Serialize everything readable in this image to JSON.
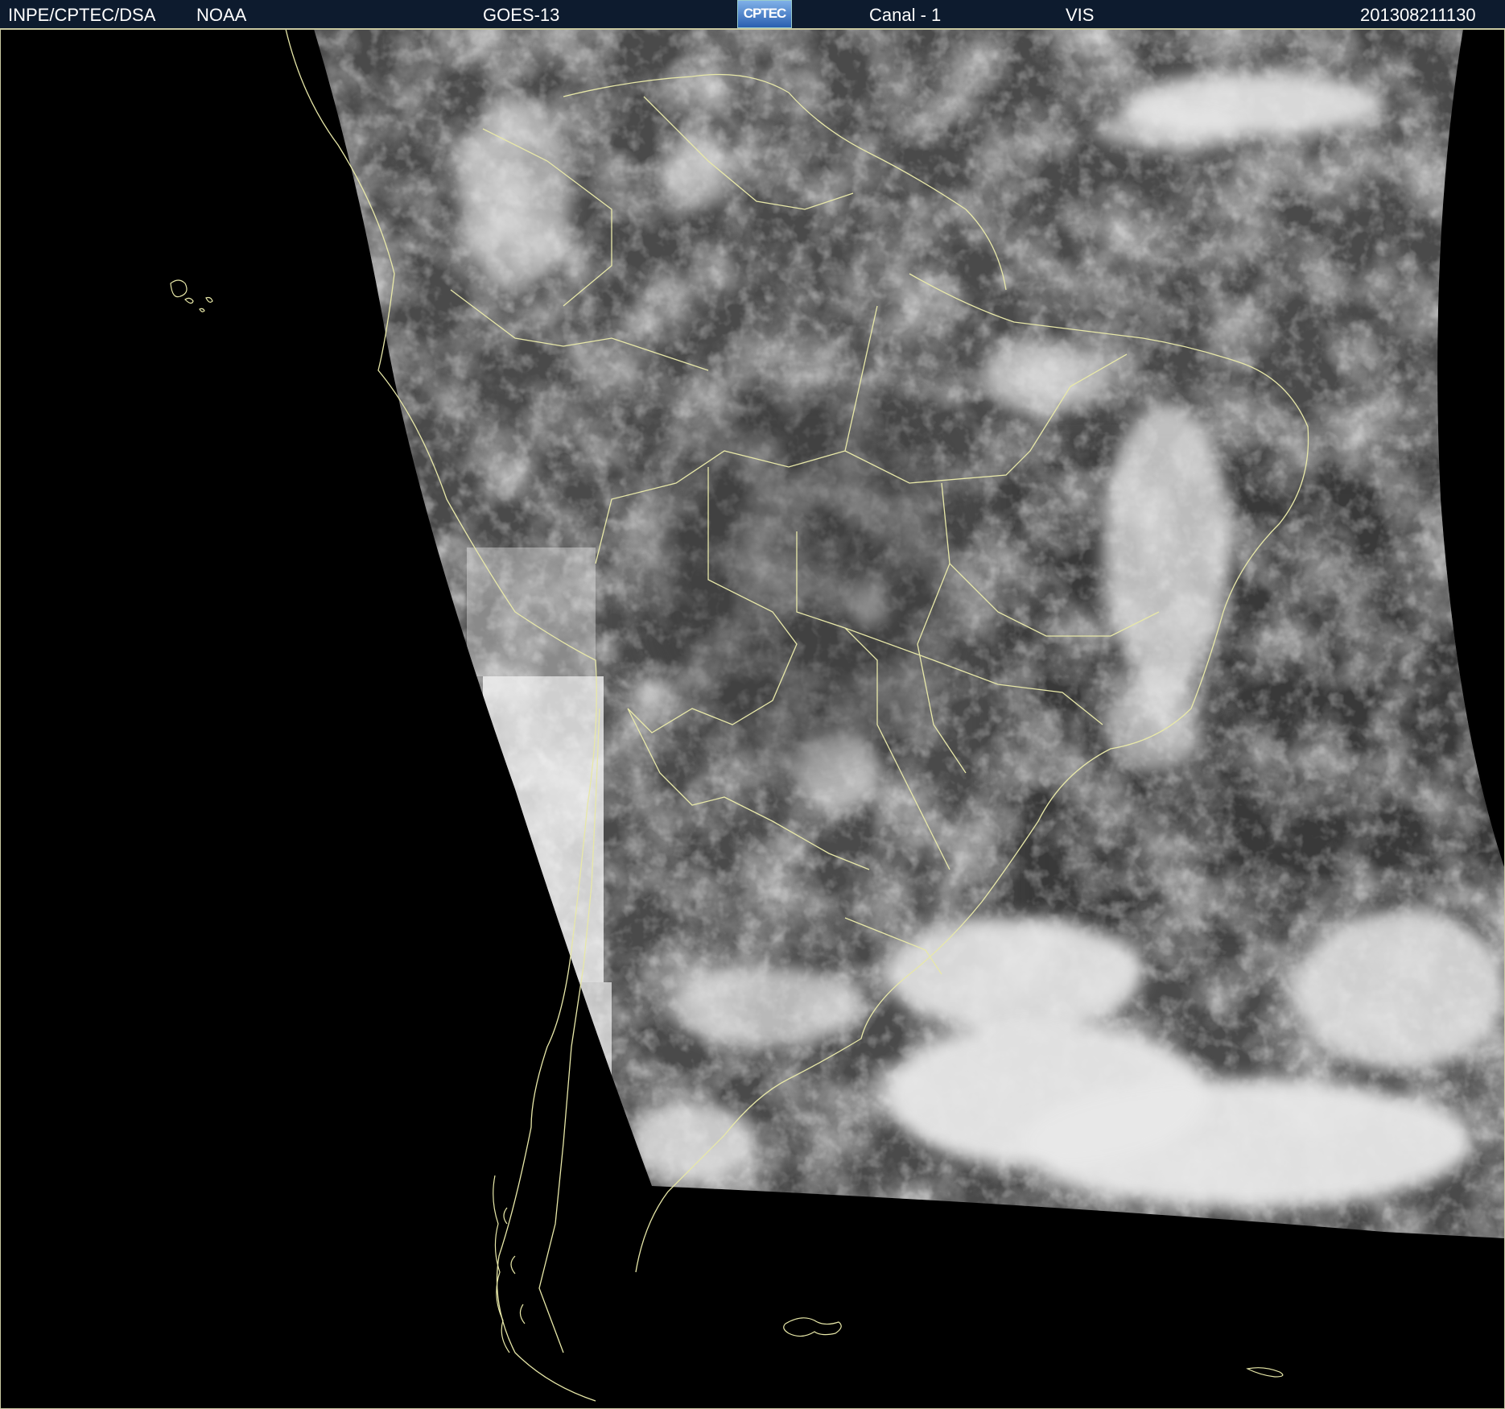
{
  "header": {
    "org": "INPE/CPTEC/DSA",
    "agency": "NOAA",
    "satellite": "GOES-13",
    "logo_text": "CPTEC",
    "channel": "Canal - 1",
    "band": "VIS",
    "timestamp": "201308211130"
  },
  "colors": {
    "header_bg": "#0d1b2e",
    "border_lines": "#e8e8a8",
    "background": "#000000"
  }
}
